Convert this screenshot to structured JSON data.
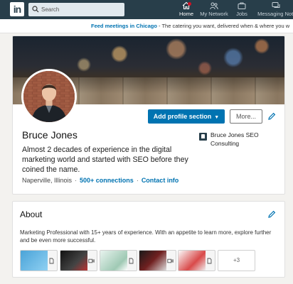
{
  "nav": {
    "logo": "in",
    "search_placeholder": "Search",
    "items": [
      {
        "label": "Home",
        "icon": "home-icon"
      },
      {
        "label": "My Network",
        "icon": "network-icon"
      },
      {
        "label": "Jobs",
        "icon": "jobs-icon"
      },
      {
        "label": "Messaging Noti",
        "icon": "messaging-icon"
      }
    ]
  },
  "ad": {
    "link": "Feed meetings in Chicago",
    "text": " - The catering you want, delivered when & where you w"
  },
  "profile": {
    "add_section_label": "Add profile section",
    "more_label": "More...",
    "name": "Bruce Jones",
    "headline": "Almost 2 decades of experience in the digital marketing world and started with SEO before they coined the name.",
    "location": "Naperville, Illinois",
    "connections": "500+ connections",
    "contact": "Contact info",
    "company": "Bruce Jones SEO Consulting"
  },
  "about": {
    "title": "About",
    "text": "Marketing Professional with 15+ years of experience. With an appetite to learn more, explore further and be even more successful.",
    "media": [
      {
        "type": "document"
      },
      {
        "type": "video"
      },
      {
        "type": "document"
      },
      {
        "type": "video"
      },
      {
        "type": "document"
      }
    ],
    "more_count": "+3"
  },
  "colors": {
    "nav_bg": "#283e4a",
    "accent": "#0073b1",
    "page_bg": "#f3f2ef"
  }
}
